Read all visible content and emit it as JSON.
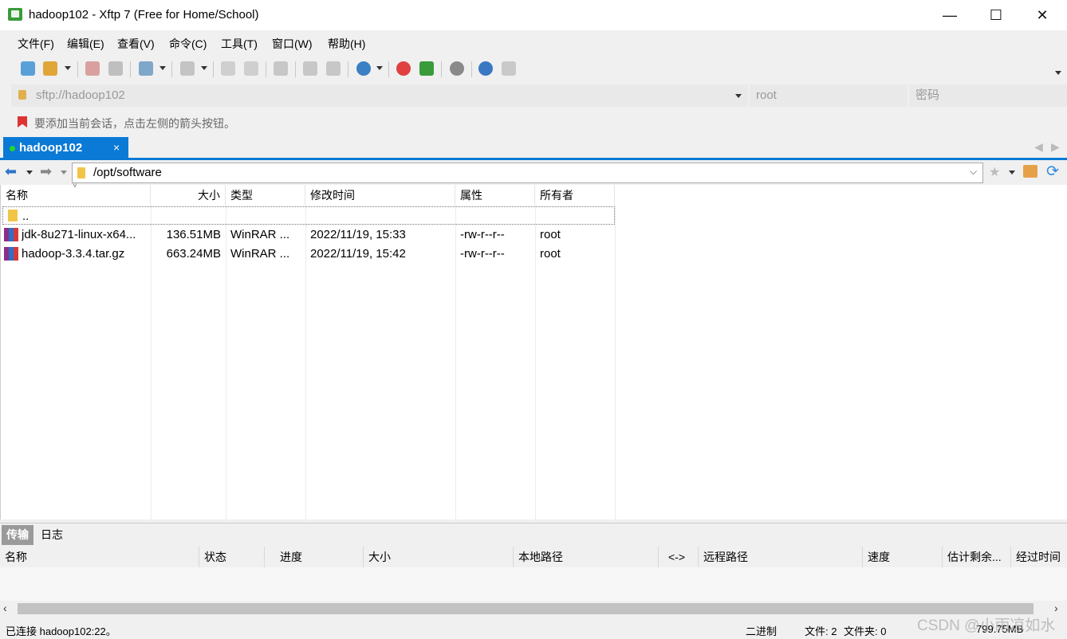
{
  "window": {
    "title": "hadoop102 - Xftp 7 (Free for Home/School)",
    "controls": {
      "minimize": "—",
      "maximize": "☐",
      "close": "✕"
    }
  },
  "menu": [
    "文件(F)",
    "编辑(E)",
    "查看(V)",
    "命令(C)",
    "工具(T)",
    "窗口(W)",
    "帮助(H)"
  ],
  "address": {
    "url_placeholder": "sftp://hadoop102",
    "user_placeholder": "root",
    "password_placeholder": "密码"
  },
  "hint": "要添加当前会话，点击左侧的箭头按钮。",
  "tabs": [
    {
      "label": "hadoop102",
      "close": "×"
    }
  ],
  "path": {
    "value": "/opt/software"
  },
  "file_list": {
    "columns": [
      "名称",
      "大小",
      "类型",
      "修改时间",
      "属性",
      "所有者"
    ],
    "parent": "..",
    "rows": [
      {
        "name": "jdk-8u271-linux-x64...",
        "size": "136.51MB",
        "type": "WinRAR ...",
        "modified": "2022/11/19, 15:33",
        "attrs": "-rw-r--r--",
        "owner": "root"
      },
      {
        "name": "hadoop-3.3.4.tar.gz",
        "size": "663.24MB",
        "type": "WinRAR ...",
        "modified": "2022/11/19, 15:42",
        "attrs": "-rw-r--r--",
        "owner": "root"
      }
    ]
  },
  "bottom_tabs": [
    "传输",
    "日志"
  ],
  "transfer_columns": [
    "名称",
    "状态",
    "进度",
    "大小",
    "本地路径",
    "<->",
    "远程路径",
    "速度",
    "估计剩余...",
    "经过时间"
  ],
  "status": {
    "connection": "已连接 hadoop102:22。",
    "mode": "二进制",
    "files": "文件: 2",
    "folders": "文件夹: 0",
    "total": "799.75MB"
  },
  "watermark": "CSDN @小雨凉如水",
  "colors": {
    "accent": "#0a7ad6",
    "background": "#f0f0f0"
  }
}
